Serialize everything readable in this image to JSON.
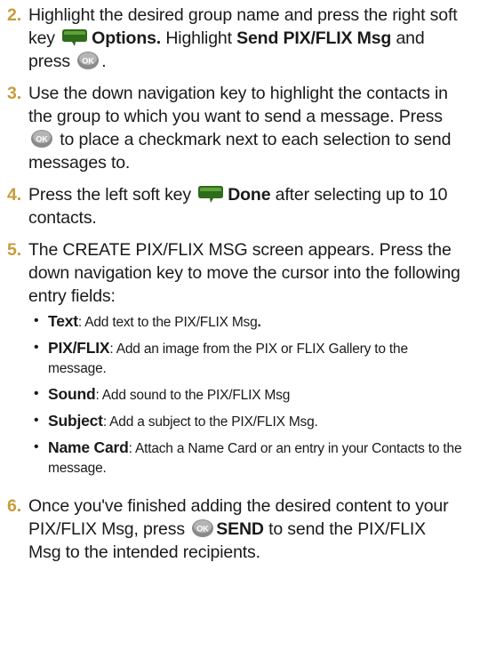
{
  "steps": [
    {
      "num": "2.",
      "t1": "Highlight the desired group name and press the right soft key ",
      "b1": "Options.",
      "t2": " Highlight ",
      "b2": "Send PIX/FLIX Msg",
      "t3": " and press ",
      "t4": "."
    },
    {
      "num": "3.",
      "t1": "Use the down navigation key to highlight the contacts in the group to which you want to send a message. Press ",
      "t2": " to place a checkmark next to each selection to send messages to."
    },
    {
      "num": "4.",
      "t1": "Press the left soft key ",
      "b1": "Done",
      "t2": " after selecting up to 10 contacts."
    },
    {
      "num": "5.",
      "t1": "The CREATE PIX/FLIX MSG screen appears. Press the down navigation key to move the cursor into the following entry fields:",
      "bullets": [
        {
          "term": "Text",
          "desc": ": Add text to the PIX/FLIX Msg",
          "tail": "."
        },
        {
          "term": "PIX/FLIX",
          "desc": ": Add an image from the PIX or FLIX Gallery to the message.",
          "tail": ""
        },
        {
          "term": "Sound",
          "desc": ": Add sound to the PIX/FLIX Msg",
          "tail": ""
        },
        {
          "term": "Subject",
          "desc": ": Add a subject to the PIX/FLIX Msg.",
          "tail": ""
        },
        {
          "term": "Name Card",
          "desc": ": Attach a Name Card or an entry in your Contacts to the message.",
          "tail": ""
        }
      ]
    },
    {
      "num": "6.",
      "t1": "Once you've finished adding the desired content to your PIX/FLIX Msg, press ",
      "b1": "SEND",
      "t2": " to send the PIX/FLIX Msg to the intended recipients."
    }
  ],
  "icons": {
    "softkey": "soft-key-icon",
    "ok": "ok-key-icon",
    "softkey_color": "#2e6b1a",
    "ok_color": "#8a8a8a"
  },
  "colors": {
    "step_number": "#c89c3c",
    "text": "#1a1a1a"
  }
}
